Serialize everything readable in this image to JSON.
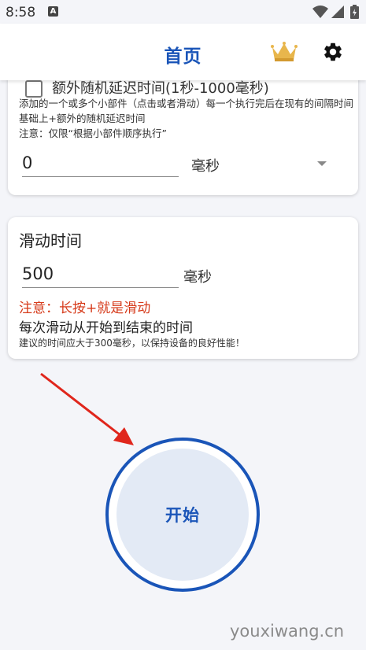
{
  "status_bar": {
    "time": "8:58",
    "notification_letter": "A",
    "icons": [
      "wifi-icon",
      "signal-icon",
      "battery-icon"
    ]
  },
  "app_bar": {
    "title": "首页",
    "icons": [
      "crown-icon",
      "gear-icon"
    ],
    "accent_color": "#1a55b8"
  },
  "delay_card": {
    "checkbox_label": "额外随机延迟时间(1秒-1000毫秒)",
    "checkbox_checked": false,
    "description": "添加的一个或多个小部件（点击或者滑动）每一个执行完后在现有的间隔时间基础上+额外的随机延迟时间",
    "note": "注意：仅限“根据小部件顺序执行”",
    "value": "0",
    "unit": "毫秒"
  },
  "swipe_card": {
    "title": "滑动时间",
    "value": "500",
    "unit": "毫秒",
    "warning": "注意：长按+就是滑动",
    "info": "每次滑动从开始到结束的时间",
    "hint": "建议的时间应大于300毫秒，以保持设备的良好性能！",
    "warning_color": "#d63a1a"
  },
  "start_button": {
    "label": "开始"
  },
  "watermark": "youxiwang.cn"
}
